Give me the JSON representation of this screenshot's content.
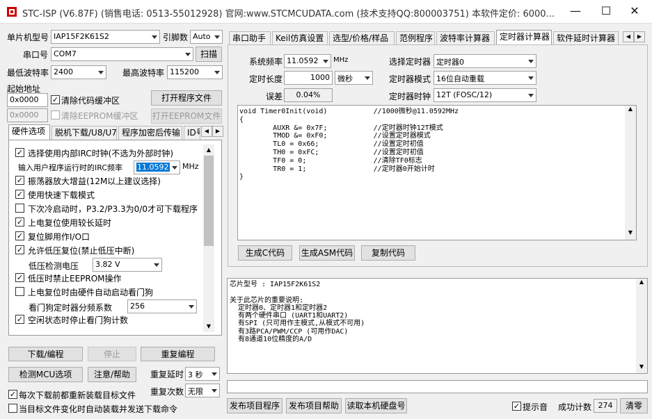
{
  "title": "STC-ISP (V6.87F) (销售电话: 0513-55012928) 官网:www.STCMCUDATA.com  (技术支持QQ:800003751) 本软件定价: 6000...",
  "window": {
    "min": "—",
    "max": "☐",
    "close": "✕"
  },
  "left": {
    "mcu_label": "单片机型号",
    "mcu_value": "IAP15F2K61S2",
    "pin_label": "引脚数",
    "pin_value": "Auto",
    "port_label": "串口号",
    "port_value": "COM7",
    "scan_btn": "扫描",
    "min_baud_label": "最低波特率",
    "min_baud_value": "2400",
    "max_baud_label": "最高波特率",
    "max_baud_value": "115200",
    "start_addr_label": "起始地址",
    "addr1": "0x0000",
    "clear_code": "清除代码缓冲区",
    "open_prog": "打开程序文件",
    "addr2": "0x0000",
    "clear_eeprom": "清除EEPROM缓冲区",
    "open_eeprom": "打开EEPROM文件",
    "tabs": [
      "硬件选项",
      "脱机下载/U8/U7",
      "程序加密后传输",
      "ID号"
    ],
    "hw_options": [
      {
        "label": "选择使用内部IRC时钟(不选为外部时钟)",
        "checked": true
      },
      {
        "label": "振荡器放大增益(12M以上建议选择)",
        "checked": true
      },
      {
        "label": "使用快速下载模式",
        "checked": true
      },
      {
        "label": "下次冷启动时，P3.2/P3.3为0/0才可下载程序",
        "checked": false
      },
      {
        "label": "上电复位使用较长延时",
        "checked": true
      },
      {
        "label": "复位脚用作I/O口",
        "checked": true
      },
      {
        "label": "允许低压复位(禁止低压中断)",
        "checked": true
      },
      {
        "label": "低压时禁止EEPROM操作",
        "checked": true
      },
      {
        "label": "上电复位时由硬件自动启动看门狗",
        "checked": false
      },
      {
        "label": "空闲状态时停止看门狗计数",
        "checked": true
      }
    ],
    "irc_label": "输入用户程序运行时的IRC频率",
    "irc_value": "11.0592",
    "irc_unit": "MHz",
    "lv_label": "低压检测电压",
    "lv_value": "3.82 V",
    "wdt_label": "看门狗定时器分频系数",
    "wdt_value": "256",
    "download_btn": "下载/编程",
    "stop_btn": "停止",
    "reprogram_btn": "重复编程",
    "check_btn": "检测MCU选项",
    "help_btn": "注意/帮助",
    "repeat_delay_label": "重复延时",
    "repeat_delay_value": "3 秒",
    "repeat_count_label": "重复次数",
    "repeat_count_value": "无限",
    "reload_each": "每次下载前都重新装载目标文件",
    "auto_send": "当目标文件变化时自动装载并发送下载命令"
  },
  "right": {
    "tabs": [
      "串口助手",
      "Keil仿真设置",
      "选型/价格/样品",
      "范例程序",
      "波特率计算器",
      "定时器计算器",
      "软件延时计算器"
    ],
    "active_tab": "定时器计算器",
    "sysfreq_label": "系统频率",
    "sysfreq_value": "11.0592",
    "sysfreq_unit": "MHz",
    "sel_timer_label": "选择定时器",
    "sel_timer_value": "定时器0",
    "len_label": "定时长度",
    "len_value": "1000",
    "len_unit": "微秒",
    "mode_label": "定时器模式",
    "mode_value": "16位自动重载",
    "err_label": "误差",
    "err_value": "0.04%",
    "clk_label": "定时器时钟",
    "clk_value": "12T (FOSC/12)",
    "code": "void Timer0Init(void)\t\t//1000微秒@11.0592MHz\n{\n\tAUXR &= 0x7F;\t\t//定时器时钟12T模式\n\tTMOD &= 0xF0;\t\t//设置定时器模式\n\tTL0 = 0x66;\t\t//设置定时初值\n\tTH0 = 0xFC;\t\t//设置定时初值\n\tTF0 = 0;\t\t//清除TF0标志\n\tTR0 = 1;\t\t//定时器0开始计时\n}",
    "gen_c": "生成C代码",
    "gen_asm": "生成ASM代码",
    "copy_code": "复制代码",
    "info": "芯片型号 : IAP15F2K61S2\n\n关于此芯片的重要说明:\n  定时器0、定时器1和定时器2\n  有两个硬件串口 (UART1和UART2)\n  有SPI (只可用作主模式,从模式不可用)\n  有3路PCA/PWM/CCP (可用作DAC)\n  有8通道10位精度的A/D",
    "pub_prog": "发布项目程序",
    "pub_help": "发布项目帮助",
    "read_disk": "读取本机硬盘号",
    "beep_label": "提示音",
    "count_label": "成功计数",
    "count_value": "274",
    "clear_btn": "清零"
  }
}
